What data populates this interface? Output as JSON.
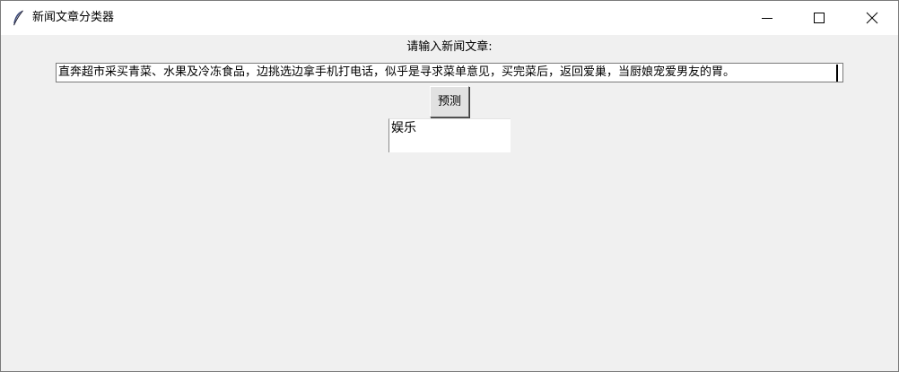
{
  "window": {
    "title": "新闻文章分类器",
    "app_icon": "feather-icon",
    "controls": {
      "minimize_icon": "minimize-icon",
      "maximize_icon": "maximize-icon",
      "close_icon": "close-icon"
    }
  },
  "form": {
    "prompt_label": "请输入新闻文章:",
    "article_text": "直奔超市采买青菜、水果及冷冻食品，边挑选边拿手机打电话，似乎是寻求菜单意见，买完菜后，返回爱巢，当厨娘宠爱男友的胃。",
    "predict_label": "预测",
    "result_text": "娱乐"
  }
}
